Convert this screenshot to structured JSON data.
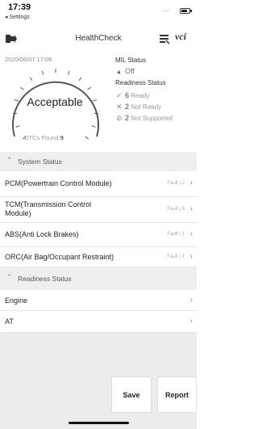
{
  "status_bar": {
    "time": "17:39",
    "back_app": "◂ Settings",
    "signal": "..."
  },
  "nav": {
    "title": "HealthCheck",
    "vci_label": "vci"
  },
  "summary": {
    "date": "2020/06/07 17:06",
    "result": "Acceptable",
    "dtc_label": "DTCs Found:",
    "dtc_count": "9",
    "mil_title": "MIL Status",
    "mil_value": "Off",
    "readiness_title": "Readiness Status",
    "ready_count": "6",
    "ready_label": "Ready",
    "not_ready_count": "2",
    "not_ready_label": "Not Ready",
    "not_supported_count": "2",
    "not_supported_label": "Not Supported"
  },
  "system_section": {
    "title": "System Status"
  },
  "system_items": [
    {
      "label": "PCM(Powertrain Control Module)",
      "fault": "Fault | 2"
    },
    {
      "label": "TCM(Transmission Control Module)",
      "fault": "Fault | 5"
    },
    {
      "label": "ABS(Anti Lock Brakes)",
      "fault": "Fault | 1"
    },
    {
      "label": "ORC(Air Bag/Occupant Restraint)",
      "fault": "Fault | 1"
    }
  ],
  "readiness_section": {
    "title": "Readiness Status"
  },
  "readiness_items": [
    {
      "label": "Engine"
    },
    {
      "label": "AT"
    }
  ],
  "buttons": {
    "save": "Save",
    "report": "Report"
  },
  "colors": {
    "gauge": "#555555",
    "section_bg": "#efefef",
    "bottom_bg": "#ececec"
  }
}
